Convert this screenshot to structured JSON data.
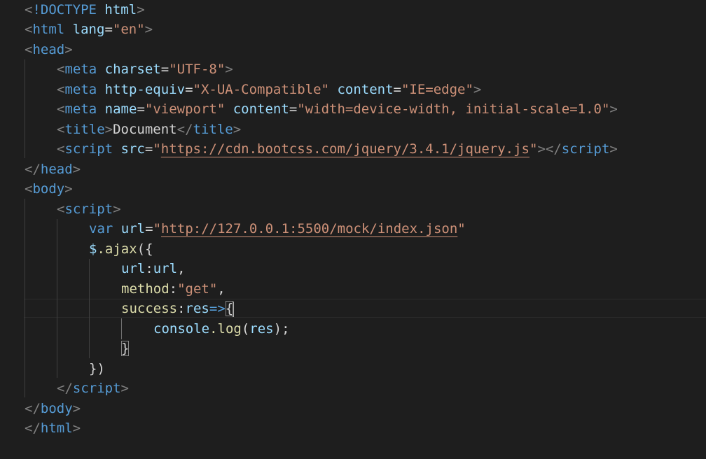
{
  "editor": {
    "language": "html",
    "theme": "dark",
    "tokens": {
      "lt": "<",
      "gt": ">",
      "lt_slash": "</",
      "eq": "=",
      "doctype_kw": "!DOCTYPE",
      "html": "html",
      "lang_attr": "lang",
      "lang_val": "\"en\"",
      "head": "head",
      "meta": "meta",
      "charset_attr": "charset",
      "charset_val": "\"UTF-8\"",
      "http_equiv_attr": "http-equiv",
      "http_equiv_val": "\"X-UA-Compatible\"",
      "content_attr": "content",
      "content_ie_val": "\"IE=edge\"",
      "name_attr": "name",
      "name_val": "\"viewport\"",
      "content_vp_val": "\"width=device-width, initial-scale=1.0\"",
      "title": "title",
      "title_text": "Document",
      "script": "script",
      "src_attr": "src",
      "quote": "\"",
      "src_url": "https://cdn.bootcss.com/jquery/3.4.1/jquery.js",
      "body": "body",
      "var_kw": "var",
      "url_var": "url",
      "mock_url": "http://127.0.0.1:5500/mock/index.json",
      "dollar": "$",
      "ajax": ".ajax",
      "ajax_open": "({",
      "url_key": "url",
      "colon": ":",
      "url_value": "url",
      "comma": ",",
      "method_key": "method",
      "method_val": "\"get\"",
      "success_key": "success",
      "res_param": "res",
      "arrow": "=>",
      "brace_open": "{",
      "console_obj": "console",
      "log_fn": ".log",
      "log_open": "(",
      "log_arg": "res",
      "log_close": ");",
      "brace_close": "}",
      "ajax_close": "})"
    }
  }
}
